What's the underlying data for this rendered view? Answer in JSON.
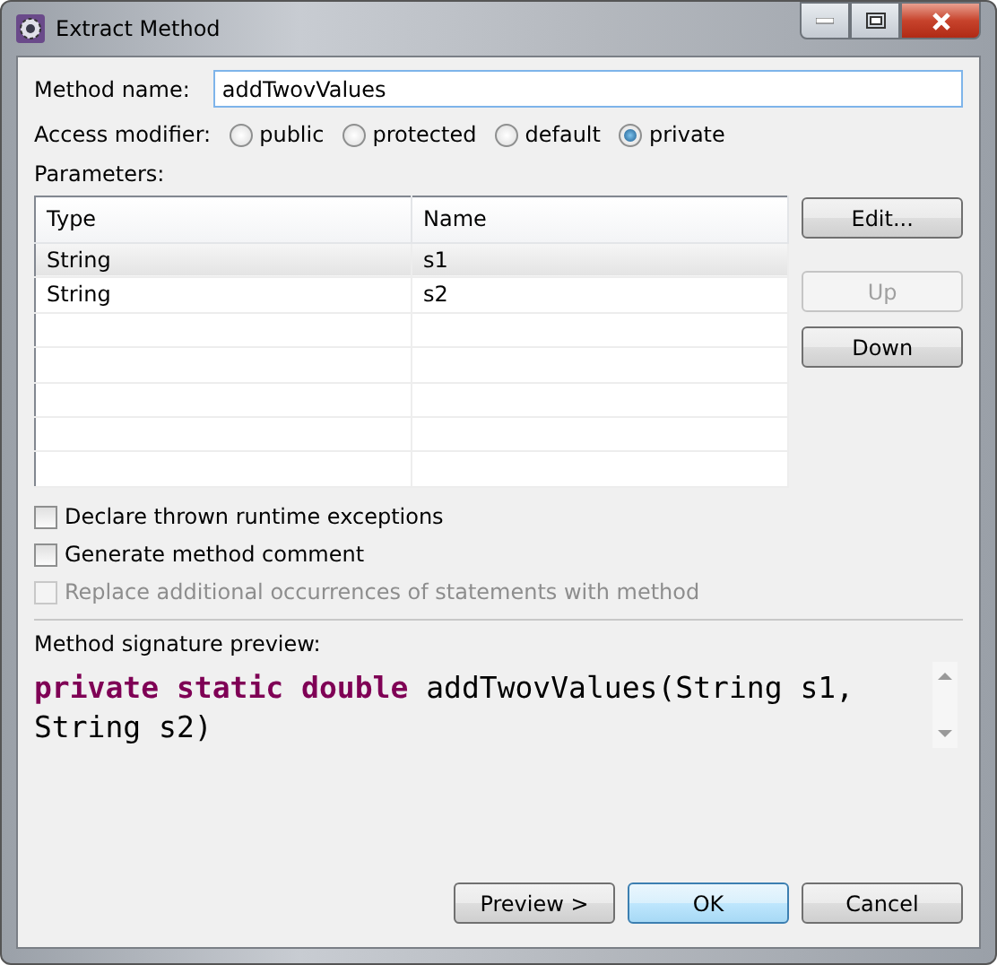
{
  "window": {
    "title": "Extract Method"
  },
  "method_name": {
    "label": "Method name:",
    "value": "addTwovValues"
  },
  "access_modifier": {
    "label": "Access modifier:",
    "options": [
      {
        "label": "public",
        "selected": false
      },
      {
        "label": "protected",
        "selected": false
      },
      {
        "label": "default",
        "selected": false
      },
      {
        "label": "private",
        "selected": true
      }
    ]
  },
  "parameters": {
    "label": "Parameters:",
    "columns": [
      "Type",
      "Name"
    ],
    "rows": [
      {
        "cells": [
          "String",
          "s1"
        ],
        "selected": true
      },
      {
        "cells": [
          "String",
          "s2"
        ],
        "selected": false
      }
    ]
  },
  "side_buttons": [
    {
      "label": "Edit...",
      "disabled": false
    },
    {
      "label": "Up",
      "disabled": true
    },
    {
      "label": "Down",
      "disabled": false
    }
  ],
  "options": [
    {
      "label": "Declare thrown runtime exceptions",
      "checked": false,
      "disabled": false
    },
    {
      "label": "Generate method comment",
      "checked": false,
      "disabled": false
    },
    {
      "label": "Replace additional occurrences of statements with method",
      "checked": false,
      "disabled": true
    }
  ],
  "preview": {
    "label": "Method signature preview:",
    "tokens": [
      {
        "kind": "keyword",
        "text": "private"
      },
      {
        "kind": "keyword",
        "text": "static"
      },
      {
        "kind": "keyword",
        "text": "double"
      },
      {
        "kind": "plain",
        "text": "addTwovValues(String"
      },
      {
        "kind": "plain",
        "text": "s1,"
      },
      {
        "kind": "plain",
        "text": "String"
      },
      {
        "kind": "plain",
        "text": "s2)"
      }
    ]
  },
  "buttons": [
    {
      "label": "Preview >",
      "default": false
    },
    {
      "label": "OK",
      "default": true
    },
    {
      "label": "Cancel",
      "default": false
    }
  ]
}
